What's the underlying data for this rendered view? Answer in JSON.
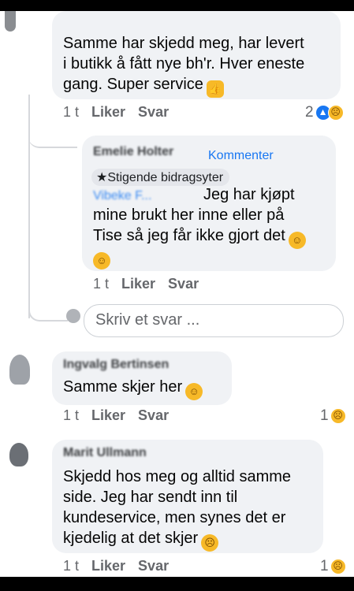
{
  "comments": [
    {
      "id": "c1",
      "author": "",
      "text_lines": [
        "Samme har skjedd meg, har levert",
        "i butikk å fått nye bh'r. Hver eneste",
        "gang. Super service"
      ],
      "end_emoji": "thumbs-up",
      "time": "1 t",
      "like_label": "Liker",
      "reply_label": "Svar",
      "reaction_count": "2",
      "reactions": [
        "like",
        "sad"
      ]
    },
    {
      "id": "r1",
      "author": "Emelie Holter",
      "top_fan_label": "Kommenter",
      "badge_label": "Stigende bidragsyter",
      "mention": "Vibeke F...",
      "text_lines": [
        "Jeg har kjøpt",
        "mine brukt her inne eller på",
        "Tise så jeg får ikke gjort det"
      ],
      "end_emojis": [
        "smirk",
        "sweat-smile"
      ],
      "time": "1 t",
      "like_label": "Liker",
      "reply_label": "Svar"
    },
    {
      "id": "c2",
      "author": "Ingvalg Bertinsen",
      "text_lines": [
        "Samme skjer her"
      ],
      "end_emoji": "sweat-smile",
      "time": "1 t",
      "like_label": "Liker",
      "reply_label": "Svar",
      "reaction_count": "1",
      "reactions": [
        "sad"
      ]
    },
    {
      "id": "c3",
      "author": "Marit Ullmann",
      "text_lines": [
        "Skjedd hos meg og alltid samme",
        "side. Jeg har sendt inn til",
        "kundeservice, men synes det er",
        "kjedelig at det skjer"
      ],
      "end_emoji": "disappointed",
      "time": "1 t",
      "like_label": "Liker",
      "reply_label": "Svar",
      "reaction_count": "1",
      "reactions": [
        "sad"
      ]
    }
  ],
  "reply_input": {
    "placeholder": "Skriv et svar ..."
  },
  "colors": {
    "bubble": "#f0f2f5",
    "meta_text": "#65676b",
    "accent": "#1877f2",
    "thread_line": "#d6d8dc"
  }
}
